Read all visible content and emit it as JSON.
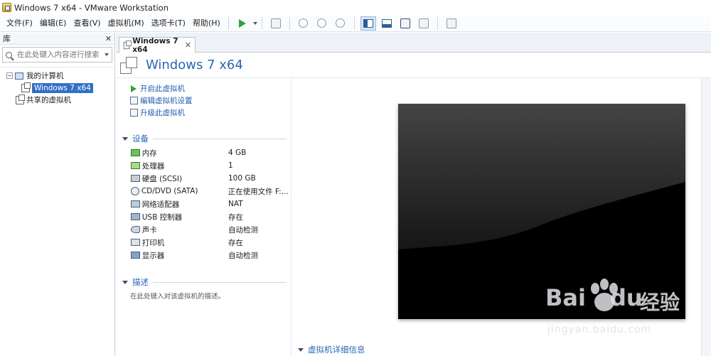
{
  "window": {
    "title": "Windows 7 x64 - VMware Workstation"
  },
  "menu": [
    "文件(F)",
    "编辑(E)",
    "查看(V)",
    "虚拟机(M)",
    "选项卡(T)",
    "帮助(H)"
  ],
  "toolbar": {
    "icons": [
      "play-icon",
      "send-keys-icon",
      "snapshot-take-icon",
      "snapshot-revert-icon",
      "snapshot-manager-icon",
      "console-view-icon",
      "thumbnail-view-icon",
      "fullscreen-icon",
      "unity-icon",
      "library-icon"
    ]
  },
  "library": {
    "title": "库",
    "search_placeholder": "在此处键入内容进行搜索",
    "tree": {
      "root": "我的计算机",
      "vm": "Windows 7 x64",
      "shared": "共享的虚拟机"
    }
  },
  "tab": {
    "label": "Windows 7 x64"
  },
  "vm": {
    "title": "Windows 7 x64",
    "actions": [
      "开启此虚拟机",
      "编辑虚拟机设置",
      "升级此虚拟机"
    ],
    "devices_title": "设备",
    "devices": [
      {
        "name": "内存",
        "value": "4 GB",
        "icon": "memory-icon"
      },
      {
        "name": "处理器",
        "value": "1",
        "icon": "processor-icon"
      },
      {
        "name": "硬盘 (SCSI)",
        "value": "100 GB",
        "icon": "harddisk-icon"
      },
      {
        "name": "CD/DVD (SATA)",
        "value": "正在使用文件 F:...",
        "icon": "cd-dvd-icon"
      },
      {
        "name": "网络适配器",
        "value": "NAT",
        "icon": "network-adapter-icon"
      },
      {
        "name": "USB 控制器",
        "value": "存在",
        "icon": "usb-icon"
      },
      {
        "name": "声卡",
        "value": "自动检测",
        "icon": "sound-card-icon"
      },
      {
        "name": "打印机",
        "value": "存在",
        "icon": "printer-icon"
      },
      {
        "name": "显示器",
        "value": "自动检测",
        "icon": "display-icon"
      }
    ],
    "description_title": "描述",
    "description_placeholder": "在此处键入对该虚拟机的描述。",
    "details_title": "虚拟机详细信息"
  },
  "watermark": {
    "brand_latin": "Bai",
    "brand_after": "du",
    "brand_cn": "经验",
    "url": "jingyan.baidu.com"
  },
  "colors": {
    "accent": "#2867b5",
    "selection": "#3170c6",
    "play": "#2ea43c"
  }
}
